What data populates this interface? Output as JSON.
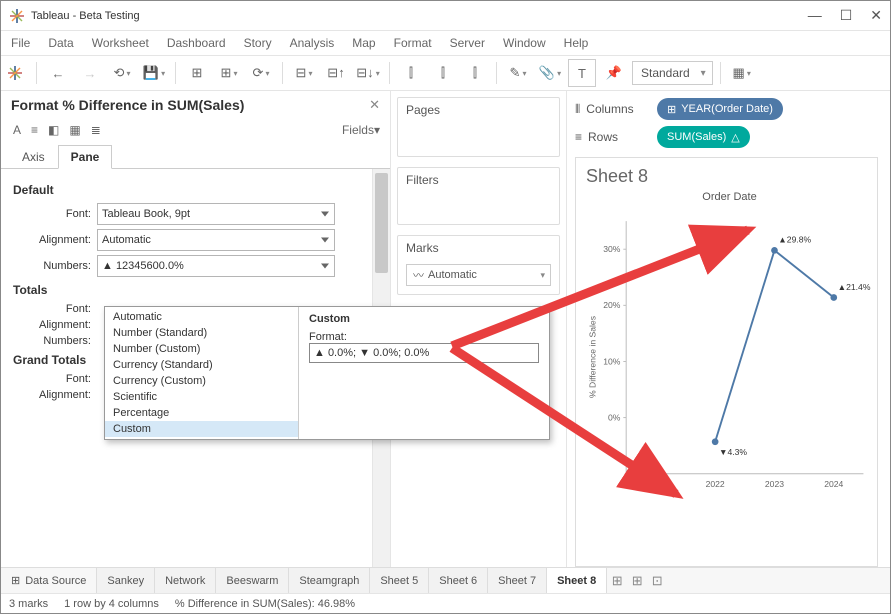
{
  "window": {
    "title": "Tableau - Beta Testing"
  },
  "menu": [
    "File",
    "Data",
    "Worksheet",
    "Dashboard",
    "Story",
    "Analysis",
    "Map",
    "Format",
    "Server",
    "Window",
    "Help"
  ],
  "toolbar": {
    "fit": "Standard"
  },
  "format": {
    "title": "Format % Difference in SUM(Sales)",
    "fields_label": "Fields",
    "tabs": {
      "axis": "Axis",
      "pane": "Pane"
    },
    "sections": {
      "default": "Default",
      "totals": "Totals",
      "grand_totals": "Grand Totals"
    },
    "labels": {
      "font": "Font:",
      "alignment": "Alignment:",
      "numbers": "Numbers:"
    },
    "values": {
      "default_font": "Tableau Book, 9pt",
      "default_align": "Automatic",
      "default_numbers": "▲ 12345600.0%"
    }
  },
  "number_format": {
    "items": [
      "Automatic",
      "Number (Standard)",
      "Number (Custom)",
      "Currency (Standard)",
      "Currency (Custom)",
      "Scientific",
      "Percentage",
      "Custom"
    ],
    "custom_label": "Custom",
    "format_label": "Format:",
    "format_value": "▲ 0.0%; ▼ 0.0%; 0.0%"
  },
  "cards": {
    "pages": "Pages",
    "filters": "Filters",
    "marks": "Marks",
    "marks_type": "Automatic"
  },
  "shelves": {
    "columns": "Columns",
    "rows": "Rows",
    "col_pill": "YEAR(Order Date)",
    "row_pill": "SUM(Sales)"
  },
  "sheet": {
    "title": "Sheet 8",
    "subtitle": "Order Date"
  },
  "chart_data": {
    "type": "line",
    "categories": [
      "2021",
      "2022",
      "2023",
      "2024"
    ],
    "values": [
      null,
      -4.3,
      29.8,
      21.4
    ],
    "labels": [
      "",
      "▼4.3%",
      "▲29.8%",
      "▲21.4%"
    ],
    "ylabel": "% Difference in Sales",
    "yticks": [
      "0%",
      "10%",
      "20%",
      "30%"
    ],
    "ylim": [
      -10,
      35
    ]
  },
  "tabs": {
    "data_source": "Data Source",
    "sheets": [
      "Sankey",
      "Network",
      "Beeswarm",
      "Steamgraph",
      "Sheet 5",
      "Sheet 6",
      "Sheet 7",
      "Sheet 8"
    ]
  },
  "status": {
    "marks": "3 marks",
    "rows_cols": "1 row by 4 columns",
    "detail": "% Difference in SUM(Sales): 46.98%"
  }
}
